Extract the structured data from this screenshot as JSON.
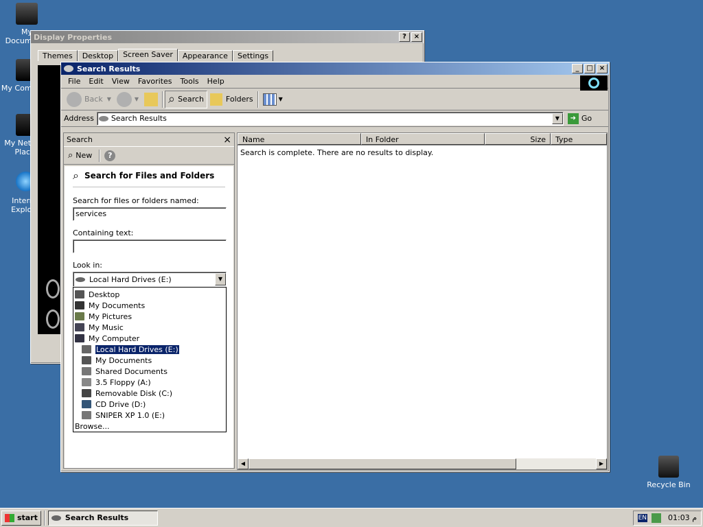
{
  "desktop": {
    "icons": [
      {
        "label": "My Documents"
      },
      {
        "label": "My Computer"
      },
      {
        "label": "My Network Places"
      },
      {
        "label": "Internet Explorer"
      },
      {
        "label": "Recycle Bin"
      }
    ]
  },
  "display_properties": {
    "title": "Display Properties",
    "help_btn": "?",
    "close_btn": "×",
    "tabs": [
      "Themes",
      "Desktop",
      "Screen Saver",
      "Appearance",
      "Settings"
    ]
  },
  "search_window": {
    "title": "Search Results",
    "btn_min": "_",
    "btn_max": "□",
    "btn_close": "×",
    "menu": [
      "File",
      "Edit",
      "View",
      "Favorites",
      "Tools",
      "Help"
    ],
    "toolbar": {
      "back": "Back",
      "search": "Search",
      "folders": "Folders"
    },
    "address": {
      "label": "Address",
      "value": "Search Results",
      "go": "Go"
    },
    "pane": {
      "title": "Search",
      "close": "×",
      "new": "New",
      "help": "?",
      "heading": "Search for Files and Folders",
      "name_label": "Search for files or folders named:",
      "name_value": "services",
      "text_label": "Containing text:",
      "text_value": "",
      "lookin_label": "Look in:",
      "lookin_value": "Local Hard Drives (E:)",
      "dropdown_items": [
        {
          "label": "Desktop",
          "indent": 0
        },
        {
          "label": "My Documents",
          "indent": 0
        },
        {
          "label": "My Pictures",
          "indent": 0
        },
        {
          "label": "My Music",
          "indent": 0
        },
        {
          "label": "My Computer",
          "indent": 0
        },
        {
          "label": "Local Hard Drives (E:)",
          "indent": 1,
          "selected": true
        },
        {
          "label": "My Documents",
          "indent": 1
        },
        {
          "label": "Shared Documents",
          "indent": 1
        },
        {
          "label": "3.5 Floppy (A:)",
          "indent": 1
        },
        {
          "label": "Removable Disk (C:)",
          "indent": 1
        },
        {
          "label": "CD Drive (D:)",
          "indent": 1
        },
        {
          "label": "SNIPER XP 1.0 (E:)",
          "indent": 1
        }
      ],
      "browse": "Browse..."
    },
    "results": {
      "columns": [
        "Name",
        "In Folder",
        "Size",
        "Type"
      ],
      "message": "Search is complete. There are no results to display."
    }
  },
  "taskbar": {
    "start": "start",
    "task": "Search Results",
    "lang": "EN",
    "time": "01:03 م"
  }
}
